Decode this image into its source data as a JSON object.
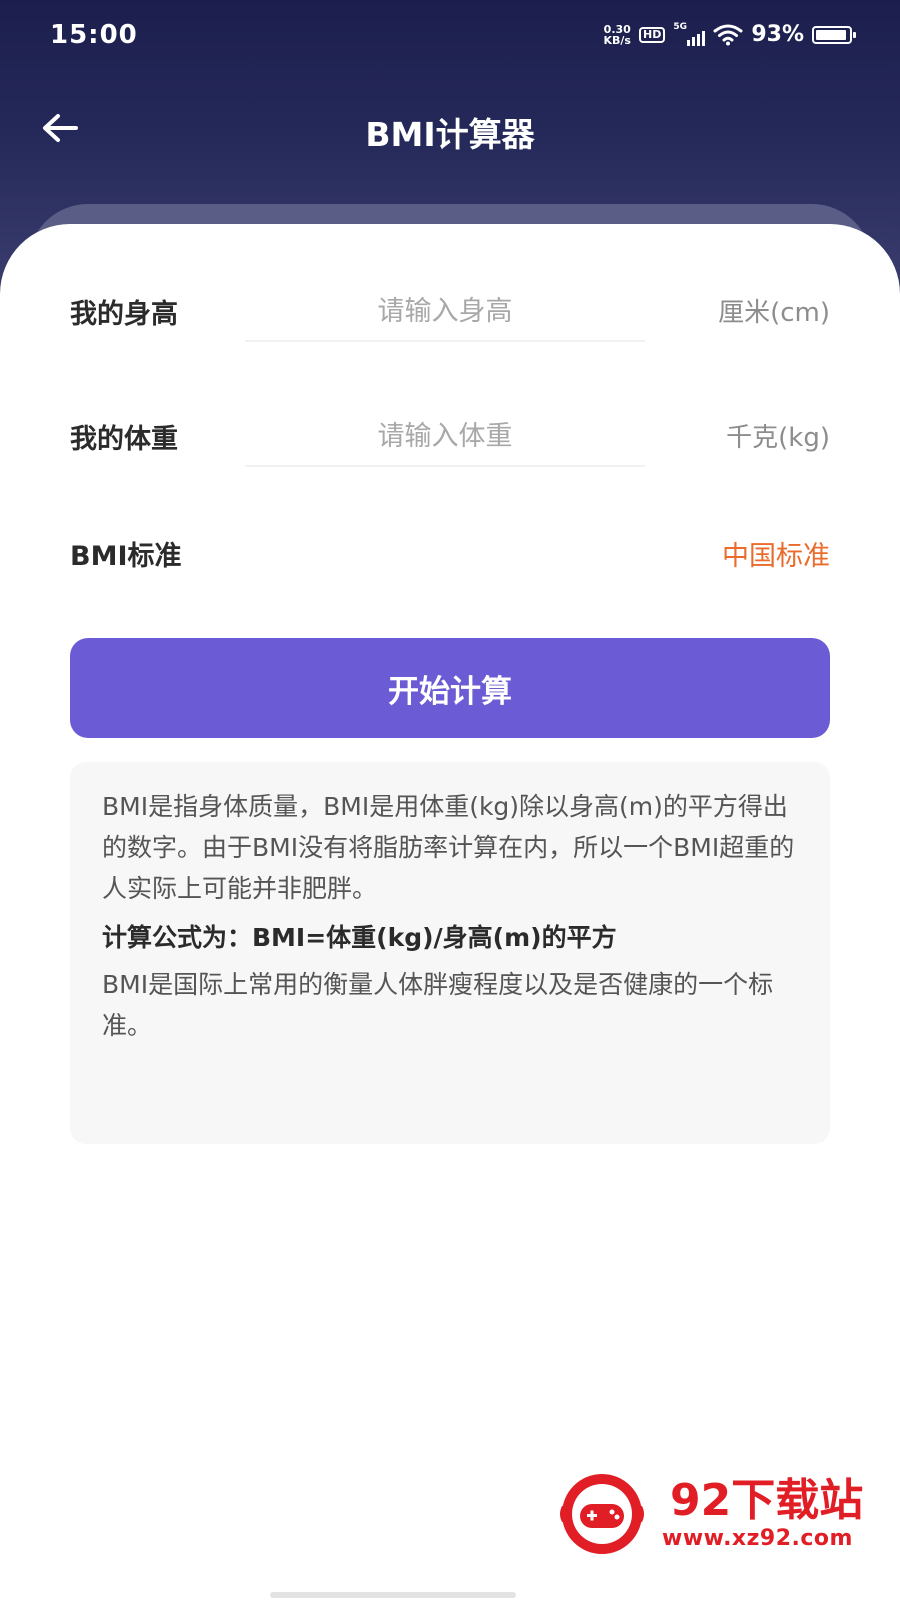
{
  "status_bar": {
    "time": "15:00",
    "net_speed_value": "0.30",
    "net_speed_unit": "KB/s",
    "hd_label": "HD",
    "network_type": "5G",
    "battery_percent": "93%",
    "battery_level": 0.93
  },
  "nav": {
    "back_icon": "arrow-left-icon",
    "title": "BMI计算器"
  },
  "form": {
    "height_label": "我的身高",
    "height_placeholder": "请输入身高",
    "height_unit": "厘米(cm)",
    "weight_label": "我的体重",
    "weight_placeholder": "请输入体重",
    "weight_unit": "千克(kg)",
    "standard_label": "BMI标准",
    "standard_value": "中国标准",
    "calculate_button": "开始计算"
  },
  "info": {
    "description": "BMI是指身体质量，BMI是用体重(kg)除以身高(m)的平方得出的数字。由于BMI没有将脂肪率计算在内，所以一个BMI超重的人实际上可能并非肥胖。",
    "formula": "计算公式为：BMI=体重(kg)/身高(m)的平方",
    "note": "BMI是国际上常用的衡量人体胖瘦程度以及是否健康的一个标准。"
  },
  "watermark": {
    "title": "92下载站",
    "url": "www.xz92.com"
  },
  "colors": {
    "header_dark": "#1c1f4d",
    "button_purple": "#6b5bd4",
    "standard_orange": "#ea6b2c",
    "watermark_red": "#e11d25"
  }
}
